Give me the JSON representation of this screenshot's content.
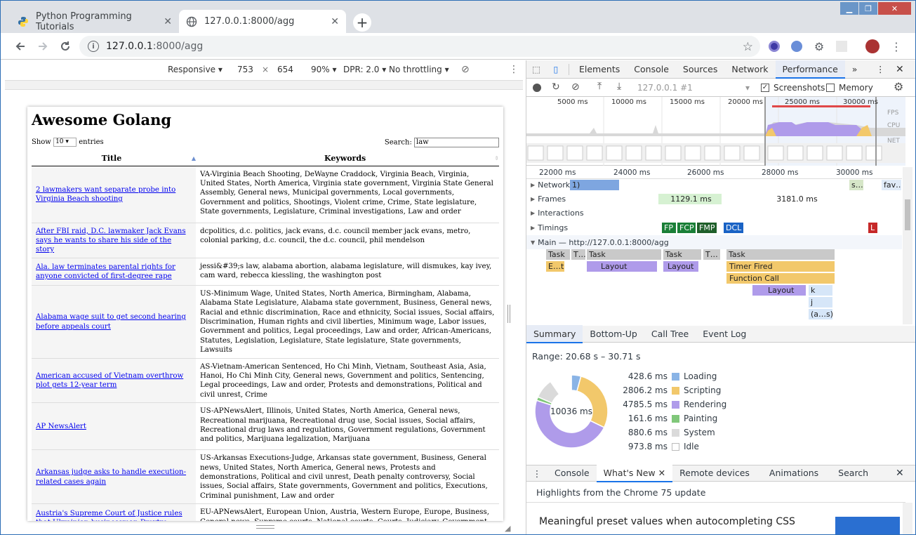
{
  "browser": {
    "tabs": [
      {
        "title": "Python Programming Tutorials"
      },
      {
        "title": "127.0.0.1:8000/agg"
      }
    ],
    "new_tab": "+",
    "address": {
      "host": "127.0.0.1",
      "path": ":8000/agg"
    },
    "window_controls": [
      "minimize",
      "maximize",
      "close"
    ]
  },
  "device_toolbar": {
    "mode": "Responsive",
    "width": "753",
    "times": "×",
    "height": "654",
    "zoom": "90%",
    "dpr": "DPR: 2.0",
    "throttle": "No throttling"
  },
  "page": {
    "title": "Awesome Golang",
    "show_label": "Show",
    "entries_value": "10",
    "entries_label": "entries",
    "search_label": "Search:",
    "search_value": "law",
    "columns": [
      "Title",
      "Keywords"
    ],
    "rows": [
      {
        "title": "2 lawmakers want separate probe into Virginia Beach shooting",
        "keywords": "VA-Virginia Beach Shooting, DeWayne Craddock, Virginia Beach, Virginia, United States, North America, Virginia state government, Virginia State General Assembly, General news, Municipal governments, Local governments, Government and politics, Shootings, Violent crime, Crime, State legislature, State governments, Legislature, Criminal investigations, Law and order"
      },
      {
        "title": "After FBI raid, D.C. lawmaker Jack Evans says he wants to share his side of the story",
        "keywords": "dcpolitics, d.c. politics, jack evans, d.c. council member jack evans, metro, colonial parking, d.c. council, the d.c. council, phil mendelson"
      },
      {
        "title": "Ala. law terminates parental rights for anyone convicted of first-degree rape",
        "keywords": "jessi&#39;s law, alabama abortion, alabama legislature, will dismukes, kay ivey, cam ward, rebecca kiessling, the washington post"
      },
      {
        "title": "Alabama wage suit to get second hearing before appeals court",
        "keywords": "US-Minimum Wage, United States, North America, Birmingham, Alabama, Alabama State Legislature, Alabama state government, Business, General news, Racial and ethnic discrimination, Race and ethnicity, Social issues, Social affairs, Discrimination, Human rights and civil liberties, Minimum wage, Labor issues, Government and politics, Legal proceedings, Law and order, African-Americans, Statutes, Legislation, Legislature, State legislature, State governments, Lawsuits"
      },
      {
        "title": "American accused of Vietnam overthrow plot gets 12-year term",
        "keywords": "AS-Vietnam-American Sentenced, Ho Chi Minh, Vietnam, Southeast Asia, Asia, Hanoi, Ho Chi Minh City, General news, Government and politics, Sentencing, Legal proceedings, Law and order, Protests and demonstrations, Political and civil unrest, Crime"
      },
      {
        "title": "AP NewsAlert",
        "keywords": "US-APNewsAlert, Illinois, United States, North America, General news, Recreational marijuana, Recreational drug use, Social issues, Social affairs, Recreational drug laws and regulations, Government regulations, Government and politics, Marijuana legalization, Marijuana"
      },
      {
        "title": "Arkansas judge asks to handle execution-related cases again",
        "keywords": "US-Arkansas Executions-Judge, Arkansas state government, Business, General news, United States, North America, General news, Protests and demonstrations, Political and civil unrest, Death penalty controversy, Social issues, Social affairs, State governments, Government and politics, Executions, Criminal punishment, Law and order"
      },
      {
        "title": "Austria's Supreme Court of Justice rules that Ukrainian businessman Dmytro Firtash can be extradited to the U.S.",
        "keywords": "EU-APNewsAlert, European Union, Austria, Western Europe, Europe, Business, General news, Supreme courts, National courts, Courts, Judiciary, Government and politics, National governments, Extradition, Law and order"
      }
    ]
  },
  "devtools": {
    "tabs": [
      "Elements",
      "Console",
      "Sources",
      "Network",
      "Performance",
      "»"
    ],
    "selected_tab": "Performance",
    "recording_target": "127.0.0.1 #1",
    "screenshots_label": "Screenshots",
    "screenshots_checked": true,
    "memory_label": "Memory",
    "memory_checked": false,
    "overview_ticks": [
      "5000 ms",
      "10000 ms",
      "15000 ms",
      "20000 ms",
      "25000 ms",
      "30000 ms"
    ],
    "overview_lanes": [
      "FPS",
      "CPU",
      "NET"
    ],
    "timeline_ticks": [
      "22000 ms",
      "24000 ms",
      "26000 ms",
      "28000 ms",
      "30000 ms"
    ],
    "tracks": {
      "network": "Network",
      "network_badge": "1)",
      "network_items": [
        "s…",
        "fav…"
      ],
      "frames": "Frames",
      "frame_times": [
        "1129.1 ms",
        "3181.0 ms"
      ],
      "interactions": "Interactions",
      "timings": "Timings",
      "markers": [
        "FP",
        "FCP",
        "FMP",
        "DCL",
        "L"
      ],
      "main": "Main — http://127.0.0.1:8000/agg",
      "tasks": [
        "Task",
        "T…",
        "Task",
        "Task",
        "T…",
        "Task"
      ],
      "events": [
        "E…t",
        "Layout",
        "Layout",
        "Timer Fired",
        "Function Call",
        "Layout",
        "k",
        "j",
        "(a…s)"
      ]
    },
    "summary_tabs": [
      "Summary",
      "Bottom-Up",
      "Call Tree",
      "Event Log"
    ],
    "range": "Range: 20.68 s – 30.71 s",
    "total": "10036 ms",
    "breakdown": [
      {
        "ms": "428.6 ms",
        "label": "Loading",
        "color": "#8ab4e6"
      },
      {
        "ms": "2806.2 ms",
        "label": "Scripting",
        "color": "#f2c86b"
      },
      {
        "ms": "4785.5 ms",
        "label": "Rendering",
        "color": "#af9bea"
      },
      {
        "ms": "161.6 ms",
        "label": "Painting",
        "color": "#80c77a"
      },
      {
        "ms": "880.6 ms",
        "label": "System",
        "color": "#dadada"
      },
      {
        "ms": "973.8 ms",
        "label": "Idle",
        "color": "#ffffff"
      }
    ],
    "drawer_tabs": [
      "Console",
      "What's New",
      "Remote devices",
      "Animations",
      "Search"
    ],
    "drawer_selected": "What's New",
    "whatsnew_header": "Highlights from the Chrome 75 update",
    "whatsnew_item": "Meaningful preset values when autocompleting CSS"
  }
}
